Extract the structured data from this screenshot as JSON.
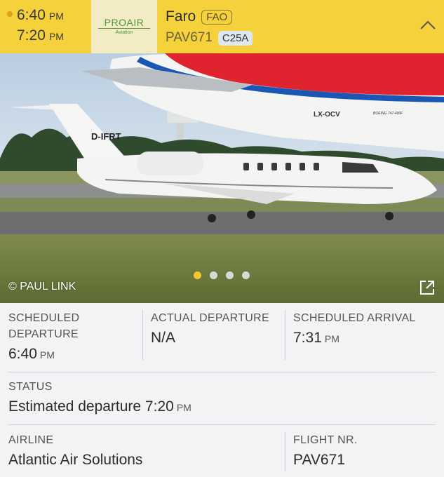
{
  "header": {
    "scheduled_time": "6:40",
    "scheduled_ampm": "PM",
    "estimated_time": "7:20",
    "estimated_ampm": "PM",
    "airline_logo_text": "PROAIR",
    "airline_logo_sub": "Aviation",
    "destination_city": "Faro",
    "destination_code": "FAO",
    "flight_number": "PAV671",
    "aircraft_type": "C25A",
    "collapse_icon": "chevron-up-icon",
    "accent_color": "#f5d13c"
  },
  "photo": {
    "credit": "© PAUL LINK",
    "tail_registration": "D-IFRT",
    "background_registration": "LX-OCV",
    "background_model": "BOEING 747-400F",
    "carousel": {
      "count": 4,
      "active_index": 0
    },
    "open_icon": "external-link-icon"
  },
  "details": {
    "scheduled_departure": {
      "label_line1": "SCHEDULED",
      "label_line2": "DEPARTURE",
      "time": "6:40",
      "ampm": "PM"
    },
    "actual_departure": {
      "label": "ACTUAL DEPARTURE",
      "value": "N/A"
    },
    "scheduled_arrival": {
      "label": "SCHEDULED ARRIVAL",
      "time": "7:31",
      "ampm": "PM"
    },
    "status": {
      "label": "STATUS",
      "text": "Estimated departure 7:20",
      "ampm": "PM"
    },
    "airline": {
      "label": "AIRLINE",
      "value": "Atlantic Air Solutions"
    },
    "flight_nr": {
      "label": "FLIGHT NR.",
      "value": "PAV671"
    }
  }
}
